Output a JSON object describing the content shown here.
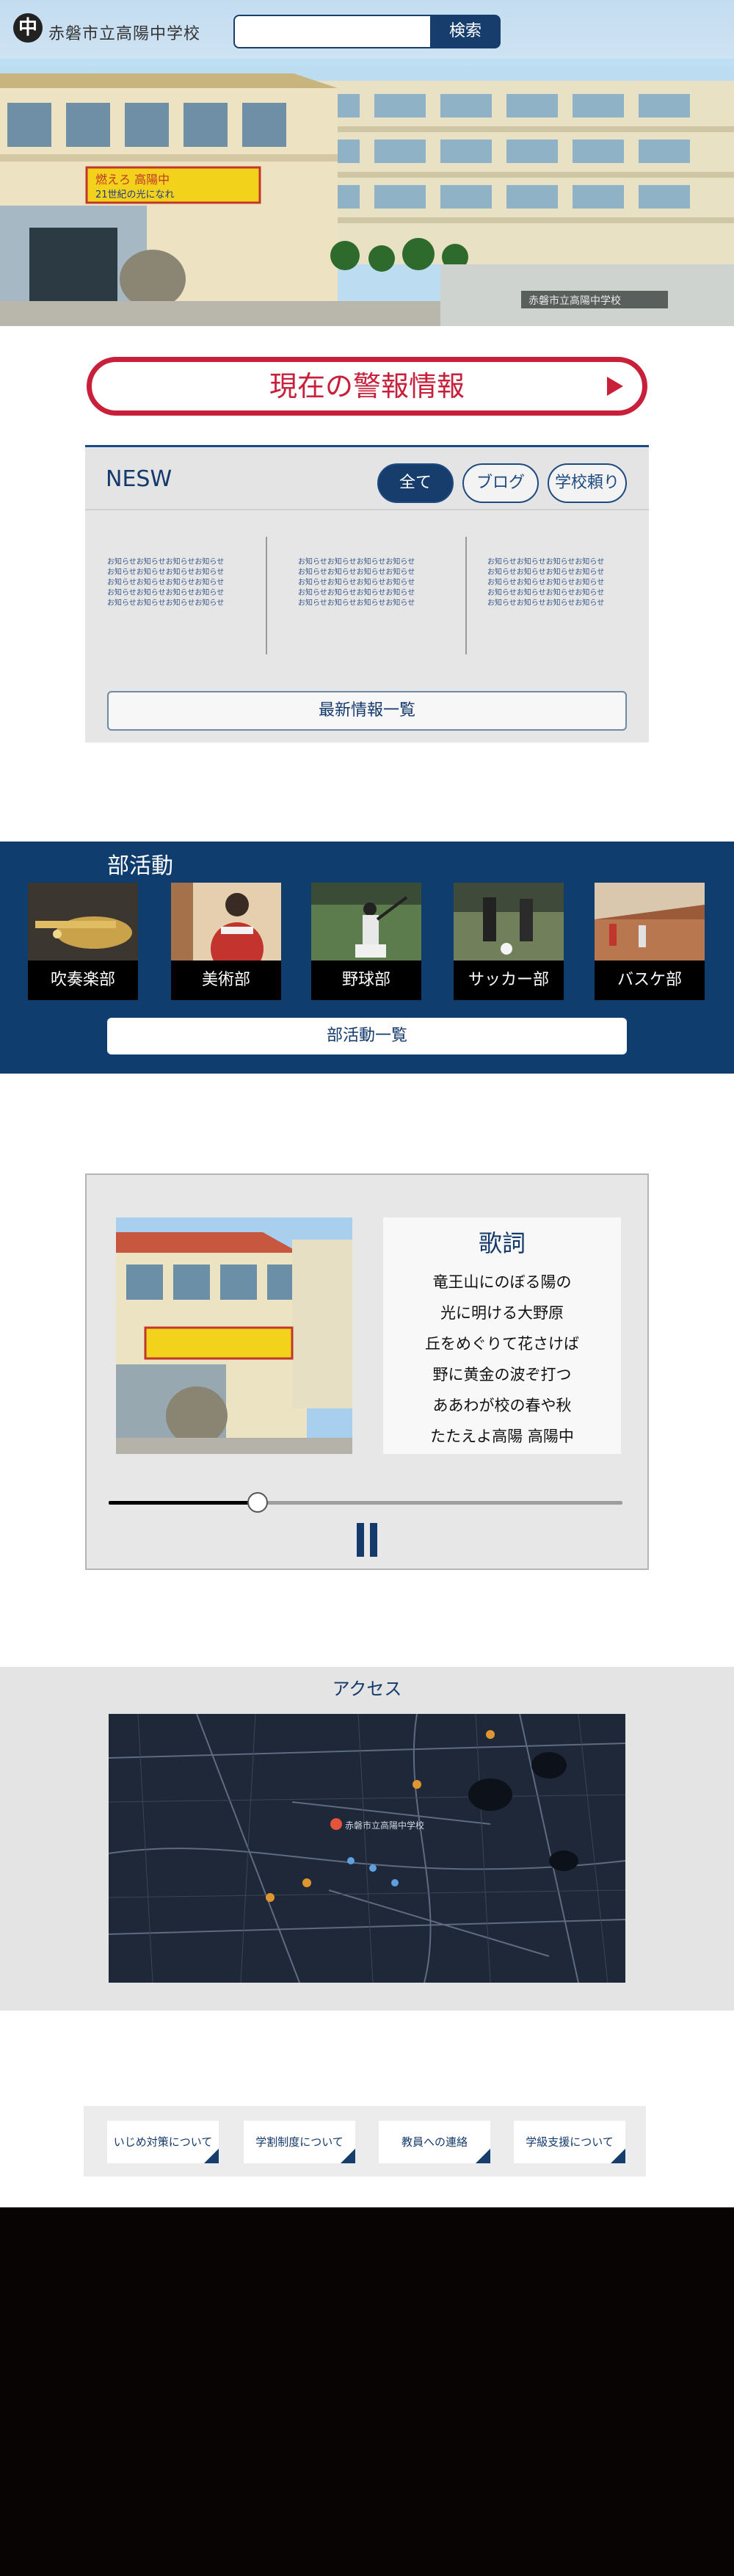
{
  "header": {
    "logo_glyph": "中",
    "school_name": "赤磐市立高陽中学校",
    "search": {
      "placeholder": "",
      "button_label": "検索"
    }
  },
  "hero": {
    "banner_text_1": "燃えろ 高陽中",
    "banner_text_2": "21世紀の光になれ",
    "sign_text": "赤磐市立高陽中学校"
  },
  "alert": {
    "label": "現在の警報情報",
    "arrow_icon": "play-triangle-icon"
  },
  "news": {
    "title": "NESW",
    "tabs": [
      {
        "label": "全て",
        "active": true
      },
      {
        "label": "ブログ",
        "active": false
      },
      {
        "label": "学校頼り",
        "active": false
      }
    ],
    "columns": [
      [
        "お知らせお知らせお知らせお知らせ",
        "お知らせお知らせお知らせお知らせ",
        "お知らせお知らせお知らせお知らせ",
        "お知らせお知らせお知らせお知らせ",
        "お知らせお知らせお知らせお知らせ"
      ],
      [
        "お知らせお知らせお知らせお知らせ",
        "お知らせお知らせお知らせお知らせ",
        "お知らせお知らせお知らせお知らせ",
        "お知らせお知らせお知らせお知らせ",
        "お知らせお知らせお知らせお知らせ"
      ],
      [
        "お知らせお知らせお知らせお知らせ",
        "お知らせお知らせお知らせお知らせ",
        "お知らせお知らせお知らせお知らせ",
        "お知らせお知らせお知らせお知らせ",
        "お知らせお知らせお知らせお知らせ"
      ]
    ],
    "more_label": "最新情報一覧"
  },
  "clubs": {
    "title": "部活動",
    "items": [
      {
        "label": "吹奏楽部"
      },
      {
        "label": "美術部"
      },
      {
        "label": "野球部"
      },
      {
        "label": "サッカー部"
      },
      {
        "label": "バスケ部"
      }
    ],
    "more_label": "部活動一覧"
  },
  "player": {
    "lyrics_title": "歌詞",
    "lyrics": [
      "竜王山にのぼる陽の",
      "光に明ける大野原",
      "丘をめぐりて花さけば",
      "野に黄金の波ぞ打つ",
      "ああわが校の春や秋",
      "たたえよ高陽 高陽中"
    ],
    "progress": 0.29,
    "pause_icon": "pause-icon"
  },
  "access": {
    "title": "アクセス",
    "map_label": "赤磐市立高陽中学校"
  },
  "links": [
    {
      "label": "いじめ対策について"
    },
    {
      "label": "学割制度について"
    },
    {
      "label": "教員への連絡"
    },
    {
      "label": "学級支援について"
    }
  ],
  "colors": {
    "navy": "#163d6b",
    "alert_red": "#c8203a",
    "footer": "#080404"
  }
}
